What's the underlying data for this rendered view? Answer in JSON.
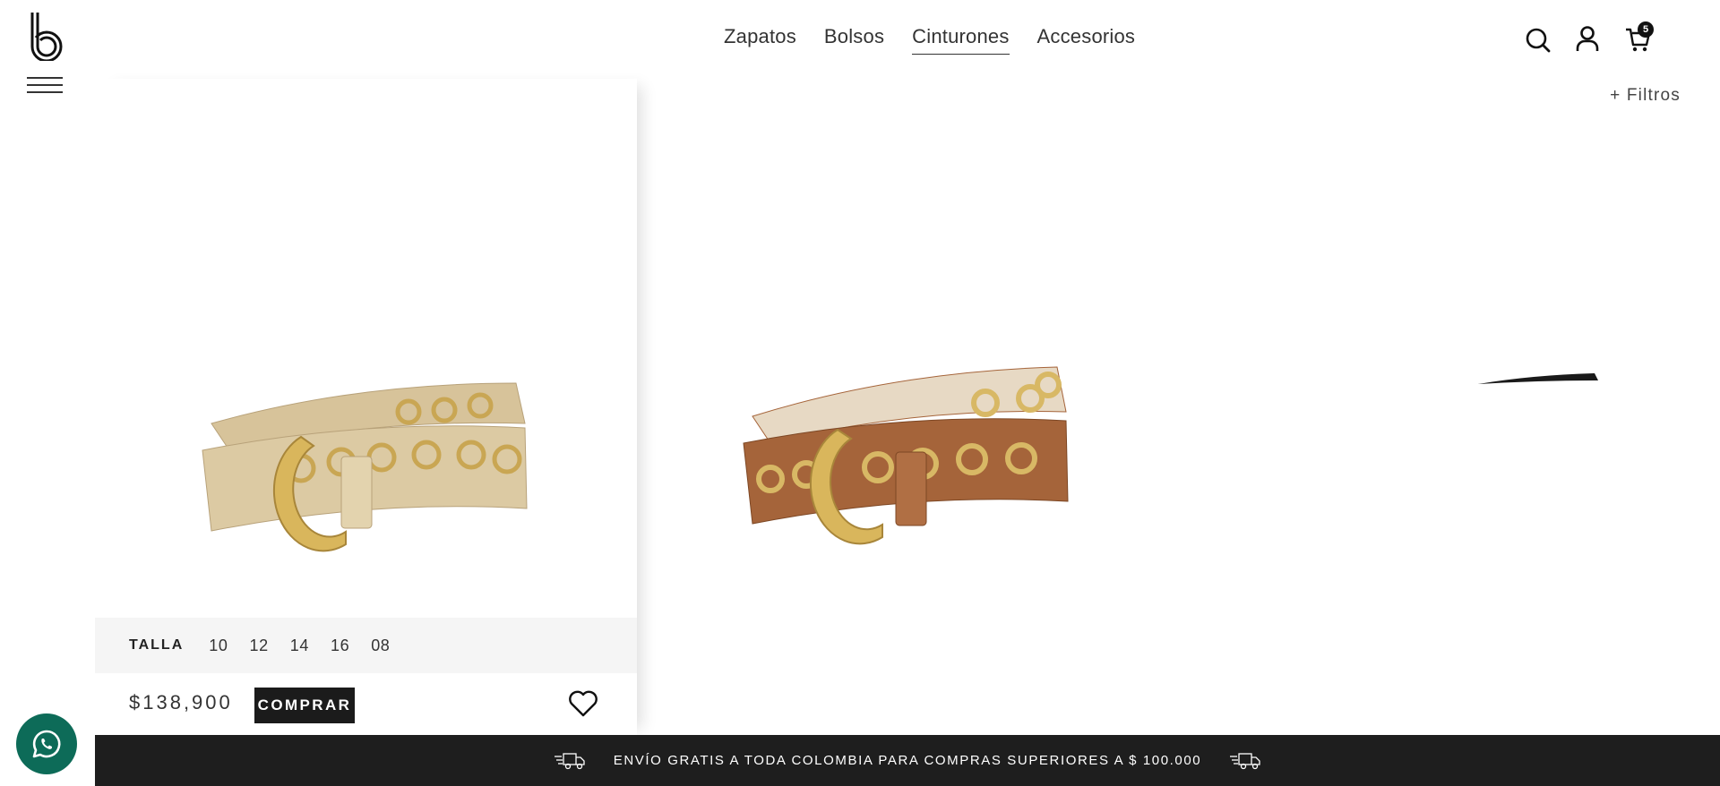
{
  "header": {
    "nav": [
      {
        "label": "Zapatos"
      },
      {
        "label": "Bolsos"
      },
      {
        "label": "Cinturones",
        "active": true
      },
      {
        "label": "Accesorios"
      }
    ],
    "cart_count": "5",
    "icons": [
      "logo-b",
      "menu-icon",
      "search-icon",
      "user-icon",
      "cart-icon"
    ]
  },
  "filters": {
    "label": "+ Filtros"
  },
  "product": {
    "size_label": "TALLA",
    "sizes": [
      "10",
      "12",
      "14",
      "16",
      "08"
    ],
    "price": "$138,900",
    "buy_label": "COMPRAR",
    "color": "gold"
  },
  "products_visible": [
    {
      "color": "gold"
    },
    {
      "color": "brown"
    },
    {
      "color": "black"
    }
  ],
  "banner": {
    "text": "ENVÍO GRATIS A TODA COLOMBIA PARA COMPRAS SUPERIORES A $ 100.000"
  },
  "colors": {
    "accent": "#1b1b1b",
    "banner_bg": "#1e1e1e",
    "whatsapp": "#0d6b58",
    "belt_gold": "#d8c49e",
    "belt_brown": "#a5643a"
  }
}
